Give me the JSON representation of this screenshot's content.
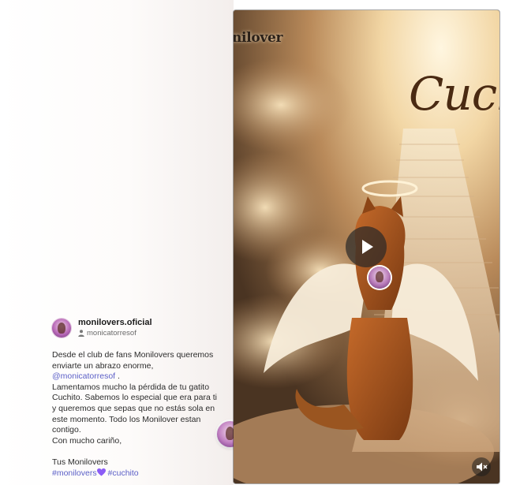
{
  "post": {
    "author_name": "monilovers.oficial",
    "author_handle": "monicatorresof",
    "caption_lines": [
      "Desde el club de fans Monilovers queremos",
      "enviarte un abrazo enorme,"
    ],
    "mention": "@monicatorresof",
    "mention_suffix": " .",
    "body_lines": [
      "Lamentamos mucho la pérdida de tu gatito",
      "Cuchito. Sabemos lo especial que era para ti",
      "y queremos que sepas que no estás sola en",
      "este momento. Todo los Monilover estan",
      "contigo.",
      "Con mucho cariño,"
    ],
    "signoff": "Tus Monilovers",
    "hashtags": [
      "#monilovers",
      "#cuchito"
    ]
  },
  "video": {
    "watermark": "nilover",
    "title_script": "Cuch",
    "icons": {
      "play": "play-icon",
      "mute": "volume-mute-icon",
      "user": "user-icon",
      "heart": "purple-heart-emoji",
      "badge": "repost-badge-icon"
    }
  },
  "colors": {
    "link": "#5b5fc7",
    "badge": "#8a49e6",
    "heart": "#8b5cf6"
  }
}
